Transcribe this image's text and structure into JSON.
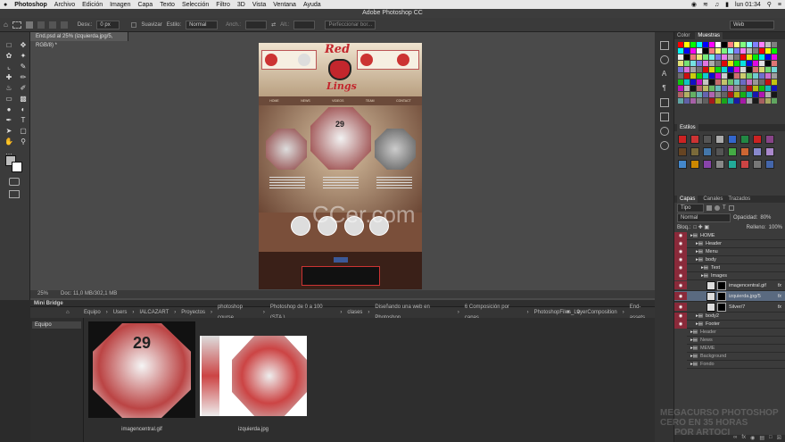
{
  "menubar": {
    "app": "Photoshop",
    "items": [
      "Archivo",
      "Edición",
      "Imagen",
      "Capa",
      "Texto",
      "Selección",
      "Filtro",
      "3D",
      "Vista",
      "Ventana",
      "Ayuda"
    ],
    "clock": "lun 01:34"
  },
  "window_title": "Adobe Photoshop CC",
  "options": {
    "desv_label": "Desv.:",
    "desv_value": "0 px",
    "suavizar": "Suavizar",
    "estilo_label": "Estilo:",
    "estilo_value": "Normal",
    "anch_label": "Anch.:",
    "alt_label": "Alt.:",
    "refine": "Perfeccionar bor...",
    "workspace": "Web"
  },
  "document": {
    "tab": "End.psd al 25% (izquierda.jpg/5, RGB/8) *",
    "zoom": "25%",
    "doc_size": "Doc: 11,0 MB/302,1 MB"
  },
  "canvas": {
    "logo_top": "Red",
    "logo_bottom": "Lings",
    "nav": [
      "HOME",
      "NEWS",
      "VIDEOS",
      "TEAM",
      "CONTACT"
    ],
    "number": "29"
  },
  "bridge": {
    "title": "Mini Bridge",
    "left_label": "Equipo",
    "path": [
      "Equipo",
      "Users",
      "IALCAZART",
      "Proyectos",
      "photoshop course",
      "Photoshop de 0 a 100 (STA )",
      "clases",
      "Diseñando una web en Photoshop",
      "6 Composición por capas",
      "PhotoshopFiles_LayerComposition",
      "End-assets"
    ],
    "thumbs": [
      {
        "name": "imagencentral.gif",
        "number": "29"
      },
      {
        "name": "izquierda.jpg",
        "number": ""
      }
    ]
  },
  "swatches_panel": {
    "tabs": [
      "Color",
      "Muestras"
    ],
    "colors": [
      "#ff0000",
      "#ffff00",
      "#00ff00",
      "#00ffff",
      "#0000ff",
      "#ff00ff",
      "#ffffff",
      "#000000",
      "#ff8080",
      "#ffff80",
      "#80ff80",
      "#80ffff",
      "#8080ff",
      "#ff80ff",
      "#c0c0c0",
      "#808080"
    ]
  },
  "styles_panel": {
    "title": "Estilos",
    "colors": [
      "#cc2222",
      "#cc3333",
      "#555555",
      "#aaaaaa",
      "#3366cc",
      "#228844",
      "#cc2222",
      "#884488",
      "#664422",
      "#7a6a3a",
      "#4477aa",
      "#555555",
      "#44aa44",
      "#cc6633",
      "#8888cc",
      "#aa88cc",
      "#4488cc",
      "#cc8800",
      "#8844aa",
      "#888888",
      "#22aa99",
      "#cc4444",
      "#777777",
      "#4466aa"
    ]
  },
  "layers_panel": {
    "tabs": [
      "Capas",
      "Canales",
      "Trazados"
    ],
    "filter": "Tipo",
    "blend": "Normal",
    "opacity_label": "Opacidad:",
    "opacity": "80%",
    "lock_label": "Bloq.:",
    "fill_label": "Relleno:",
    "fill": "100%",
    "layers": [
      {
        "name": "HOME",
        "indent": 0,
        "visible": true,
        "thumb": false,
        "fx": false
      },
      {
        "name": "Header",
        "indent": 1,
        "visible": true,
        "thumb": false,
        "fx": false
      },
      {
        "name": "Menu",
        "indent": 1,
        "visible": true,
        "thumb": false,
        "fx": false
      },
      {
        "name": "body",
        "indent": 1,
        "visible": true,
        "thumb": false,
        "fx": false
      },
      {
        "name": "Text",
        "indent": 2,
        "visible": true,
        "thumb": false,
        "fx": false
      },
      {
        "name": "Images",
        "indent": 2,
        "visible": true,
        "thumb": false,
        "fx": false
      },
      {
        "name": "imagencentral.gif",
        "indent": 3,
        "visible": true,
        "thumb": true,
        "fx": true
      },
      {
        "name": "izquierda.jpg/5",
        "indent": 3,
        "visible": true,
        "thumb": true,
        "fx": true
      },
      {
        "name": "Silver/7",
        "indent": 3,
        "visible": true,
        "thumb": true,
        "fx": true
      },
      {
        "name": "body2",
        "indent": 1,
        "visible": true,
        "thumb": false,
        "fx": false
      },
      {
        "name": "Footer",
        "indent": 1,
        "visible": true,
        "thumb": false,
        "fx": false
      },
      {
        "name": "Header",
        "indent": 0,
        "visible": false,
        "thumb": false,
        "fx": false
      },
      {
        "name": "News",
        "indent": 0,
        "visible": false,
        "thumb": false,
        "fx": false
      },
      {
        "name": "MEME",
        "indent": 0,
        "visible": false,
        "thumb": false,
        "fx": false
      },
      {
        "name": "Background",
        "indent": 0,
        "visible": false,
        "thumb": false,
        "fx": false
      },
      {
        "name": "Fondo",
        "indent": 0,
        "visible": false,
        "thumb": false,
        "fx": false
      }
    ]
  },
  "watermark": {
    "center": "CCer.com",
    "line1": "MEGACURSO PHOTOSHOP",
    "line2": "CERO EN 35 HORAS",
    "line3": "POR ARTOCI"
  }
}
